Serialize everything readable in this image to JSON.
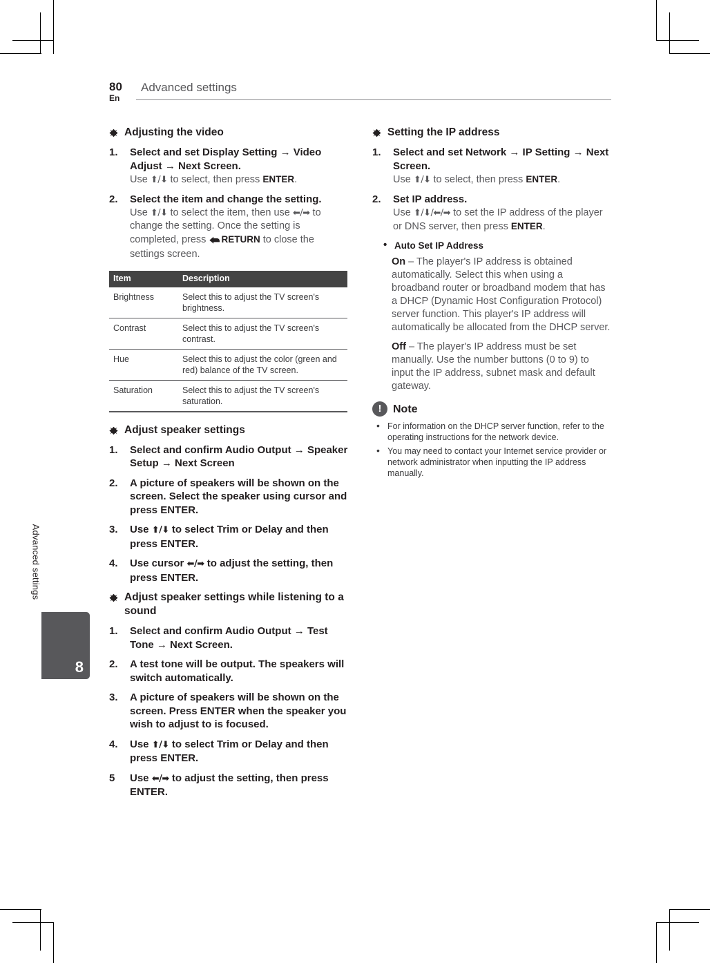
{
  "header": {
    "page_number": "80",
    "language": "En",
    "chapter_title": "Advanced settings"
  },
  "side_tab": {
    "vertical_label": "Advanced settings",
    "chapter_number": "8"
  },
  "colors": {
    "table_header_bg": "#434343",
    "side_tab_bg": "#58585b",
    "body_text": "#231f20",
    "secondary_text": "#58585b"
  },
  "left_column": {
    "section1": {
      "heading": "Adjusting the video",
      "steps": [
        {
          "number": "1.",
          "bold": "Select and set Display Setting → Video Adjust → Next Screen.",
          "sub_prefix": "Use ",
          "sub_keys": "⬆/⬇",
          "sub_mid": " to select, then press ",
          "sub_key_bold": "ENTER",
          "sub_suffix": "."
        },
        {
          "number": "2.",
          "bold": "Select the item and change the setting.",
          "sub_prefix": "Use ",
          "sub_keys": "⬆/⬇",
          "sub_mid": " to select the item, then use ",
          "sub_keys2": "⬅/➡",
          "sub_mid2": " to change the setting. Once the setting is completed, press ",
          "sub_key_bold": "RETURN",
          "sub_suffix": " to close the settings screen."
        }
      ],
      "table": {
        "columns": [
          "Item",
          "Description"
        ],
        "rows": [
          [
            "Brightness",
            "Select this to adjust the TV screen's brightness."
          ],
          [
            "Contrast",
            "Select this to adjust the TV screen's contrast."
          ],
          [
            "Hue",
            "Select this to adjust the color (green and red) balance of the TV screen."
          ],
          [
            "Saturation",
            "Select this to adjust the TV screen's saturation."
          ]
        ]
      }
    },
    "section2": {
      "heading": "Adjust speaker settings",
      "steps": [
        {
          "number": "1.",
          "bold": "Select and confirm Audio Output → Speaker Setup → Next Screen"
        },
        {
          "number": "2.",
          "bold": "A picture of speakers will be shown on the screen. Select the speaker using cursor and press ENTER."
        },
        {
          "number": "3.",
          "bold_pre": "Use ",
          "keys": "⬆/⬇",
          "bold_post": " to select Trim or Delay and then press ENTER."
        },
        {
          "number": "4.",
          "bold_pre": "Use cursor ",
          "keys": "⬅/➡",
          "bold_post": " to adjust the setting, then press ENTER."
        }
      ]
    },
    "section3": {
      "heading": "Adjust speaker settings while listening to a sound",
      "steps": [
        {
          "number": "1.",
          "bold": "Select and confirm Audio Output → Test Tone → Next Screen."
        },
        {
          "number": "2.",
          "bold": "A test tone will be output. The speakers will switch automatically."
        },
        {
          "number": "3.",
          "bold": "A picture of speakers will be shown on the screen. Press ENTER when the speaker you wish to adjust to is focused."
        },
        {
          "number": "4.",
          "bold_pre": "Use ",
          "keys": "⬆/⬇",
          "bold_post": " to select Trim or Delay and then press ENTER."
        },
        {
          "number": "5",
          "bold_pre": "Use ",
          "keys": "⬅/➡",
          "bold_post": " to adjust the setting, then press ENTER."
        }
      ]
    }
  },
  "right_column": {
    "section1": {
      "heading": "Setting the IP address",
      "steps": [
        {
          "number": "1.",
          "bold": "Select and set Network → IP Setting → Next Screen.",
          "sub_prefix": "Use ",
          "sub_keys": "⬆/⬇",
          "sub_mid": " to select, then press ",
          "sub_key_bold": "ENTER",
          "sub_suffix": "."
        },
        {
          "number": "2.",
          "bold": "Set IP address.",
          "sub_prefix": "Use ",
          "sub_keys": "⬆/⬇/⬅/➡",
          "sub_mid": " to set the IP address of the player or DNS server, then press ",
          "sub_key_bold": "ENTER",
          "sub_suffix": "."
        }
      ],
      "sub_bullet": "Auto Set IP Address",
      "definitions": [
        {
          "term": "On",
          "dash": " – ",
          "text": "The player's IP address is obtained automatically. Select this when using a broadband router or broadband modem that has a DHCP (Dynamic Host Configuration Protocol) server function. This player's IP address will automatically be allocated from the DHCP server."
        },
        {
          "term": "Off",
          "dash": " – ",
          "text": "The player's IP address must be set manually. Use the number buttons (0 to 9) to input the IP address, subnet mask and default gateway."
        }
      ]
    },
    "note": {
      "label": "Note",
      "icon_char": "!",
      "items": [
        "For information on the DHCP server function, refer to the operating instructions for the network device.",
        "You may need to contact your Internet service provider or network administrator when inputting the IP address manually."
      ]
    }
  }
}
